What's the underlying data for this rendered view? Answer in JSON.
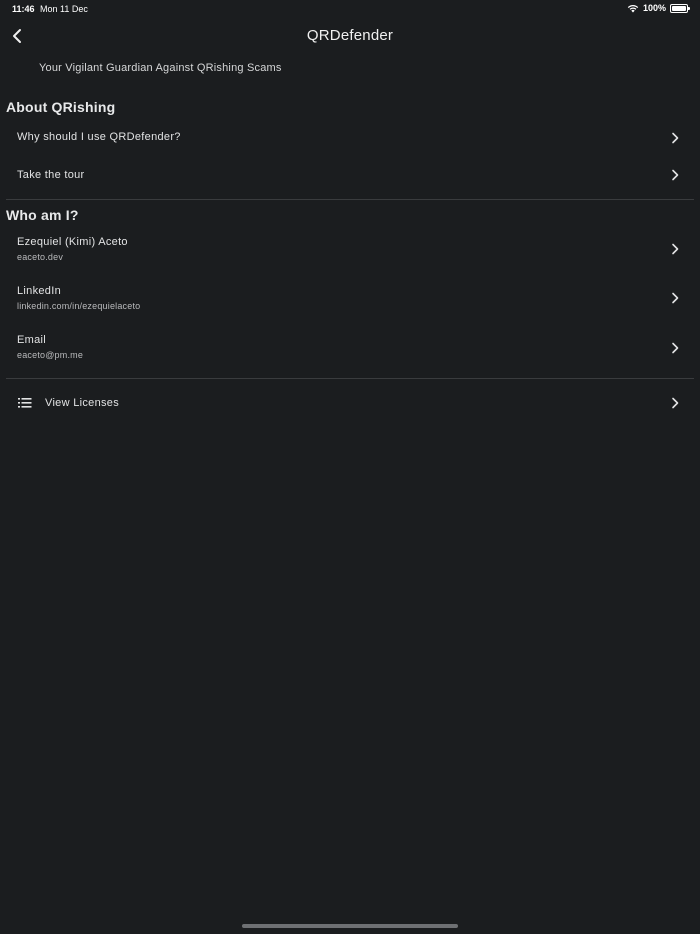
{
  "status_bar": {
    "time": "11:46",
    "date": "Mon 11 Dec",
    "battery": "100%"
  },
  "nav": {
    "title": "QRDefender",
    "back_icon": "chevron-left-icon"
  },
  "subtitle": "Your Vigilant Guardian Against QRishing Scams",
  "sections": {
    "about": {
      "header": "About QRishing",
      "items": [
        {
          "title": "Why should I use QRDefender?"
        },
        {
          "title": "Take the tour"
        }
      ]
    },
    "who": {
      "header": "Who am I?",
      "items": [
        {
          "title": "Ezequiel (Kimi) Aceto",
          "subtitle": "eaceto.dev"
        },
        {
          "title": "LinkedIn",
          "subtitle": "linkedin.com/in/ezequielaceto"
        },
        {
          "title": "Email",
          "subtitle": "eaceto@pm.me"
        }
      ]
    }
  },
  "licenses": {
    "label": "View Licenses",
    "icon": "list-icon"
  },
  "colors": {
    "background": "#1b1d1f",
    "text": "#e6e7e8",
    "divider": "#3a3c3e"
  }
}
